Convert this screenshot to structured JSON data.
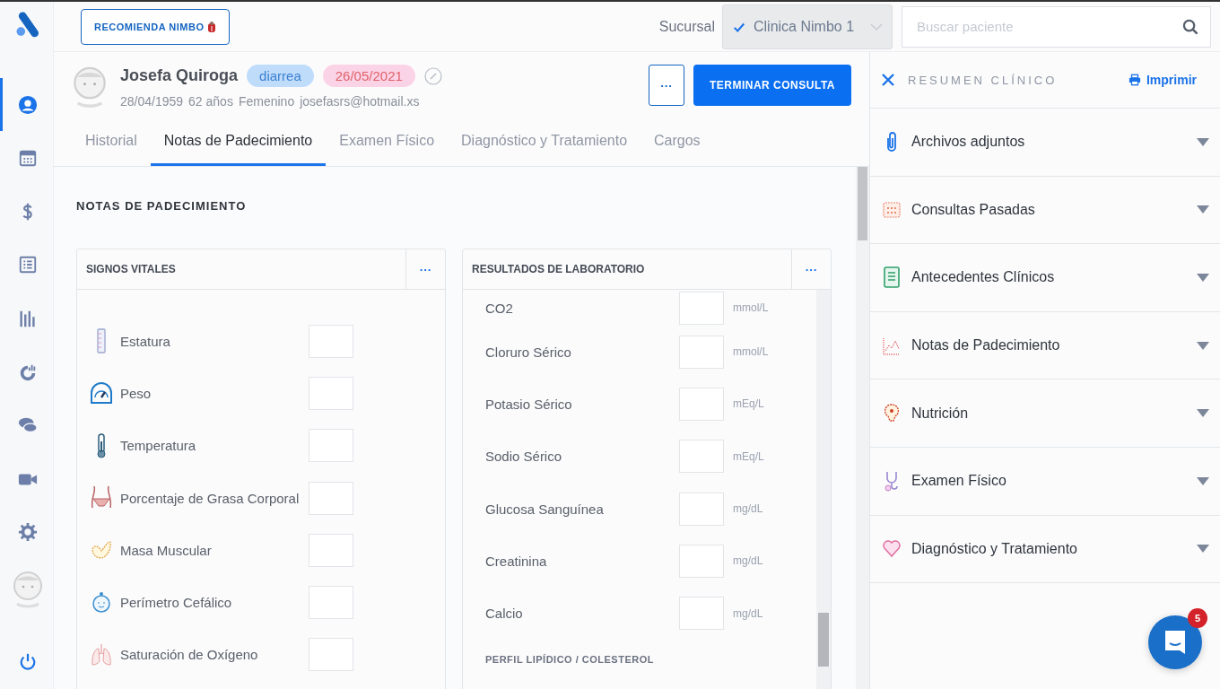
{
  "sidebar": {
    "items": [
      {
        "kind": "user",
        "selected": true
      },
      {
        "kind": "calendar",
        "selected": false
      },
      {
        "kind": "dollar",
        "selected": false
      },
      {
        "kind": "list",
        "selected": false
      },
      {
        "kind": "bars",
        "selected": false
      },
      {
        "kind": "gauge",
        "selected": false
      },
      {
        "kind": "chat",
        "selected": false
      },
      {
        "kind": "video",
        "selected": false
      },
      {
        "kind": "gear",
        "selected": false
      },
      {
        "kind": "avatar",
        "selected": false
      },
      {
        "kind": "power",
        "selected": false
      }
    ]
  },
  "topbar": {
    "recommend_button": "RECOMIENDA NIMBO",
    "branch_label": "Sucursal",
    "branch_value": "Clinica Nimbo 1",
    "search": {
      "placeholder": "Buscar paciente"
    }
  },
  "patient": {
    "name": "Josefa Quiroga",
    "tag": "diarrea",
    "date": "26/05/2021",
    "birthdate": "28/04/1959",
    "age": "62 años",
    "sex": "Femenino",
    "email": "josefasrs@hotmail.xs",
    "more_button": "···",
    "finish_button": "TERMINAR CONSULTA"
  },
  "tabs": [
    {
      "label": "Historial",
      "selected": false
    },
    {
      "label": "Notas de Padecimiento",
      "selected": true
    },
    {
      "label": "Examen Físico",
      "selected": false
    },
    {
      "label": "Diagnóstico y Tratamiento",
      "selected": false
    },
    {
      "label": "Cargos",
      "selected": false
    }
  ],
  "section_title": "NOTAS DE PADECIMIENTO",
  "vitals": {
    "title": "SIGNOS VITALES",
    "menu": "···",
    "rows": [
      {
        "kind": "ruler",
        "label": "Estatura"
      },
      {
        "kind": "scale",
        "label": "Peso"
      },
      {
        "kind": "thermometer",
        "label": "Temperatura"
      },
      {
        "kind": "waist",
        "label": "Porcentaje de Grasa Corporal"
      },
      {
        "kind": "arm",
        "label": "Masa Muscular"
      },
      {
        "kind": "baby",
        "label": "Perímetro Cefálico"
      },
      {
        "kind": "lungs",
        "label": "Saturación de Oxígeno"
      }
    ]
  },
  "labs": {
    "title": "RESULTADOS DE LABORATORIO",
    "menu": "···",
    "rows": [
      {
        "label": "CO2",
        "unit": "mmol/L"
      },
      {
        "label": "Cloruro Sérico",
        "unit": "mmol/L"
      },
      {
        "label": "Potasio Sérico",
        "unit": "mEq/L"
      },
      {
        "label": "Sodio Sérico",
        "unit": "mEq/L"
      },
      {
        "label": "Glucosa Sanguínea",
        "unit": "mg/dL"
      },
      {
        "label": "Creatinina",
        "unit": "mg/dL"
      },
      {
        "label": "Calcio",
        "unit": "mg/dL"
      }
    ],
    "subheading": "PERFIL LIPÍDICO / COLESTEROL"
  },
  "summary": {
    "title": "RESUMEN CLÍNICO",
    "print": "Imprimir",
    "items": [
      {
        "kind": "clip",
        "label": "Archivos adjuntos"
      },
      {
        "kind": "calendar",
        "label": "Consultas Pasadas"
      },
      {
        "kind": "doc",
        "label": "Antecedentes Clínicos"
      },
      {
        "kind": "chart",
        "label": "Notas de Padecimiento"
      },
      {
        "kind": "bulb",
        "label": "Nutrición"
      },
      {
        "kind": "stetho",
        "label": "Examen Físico"
      },
      {
        "kind": "heart",
        "label": "Diagnóstico y Tratamiento"
      }
    ]
  },
  "chat": {
    "badge": "5"
  }
}
